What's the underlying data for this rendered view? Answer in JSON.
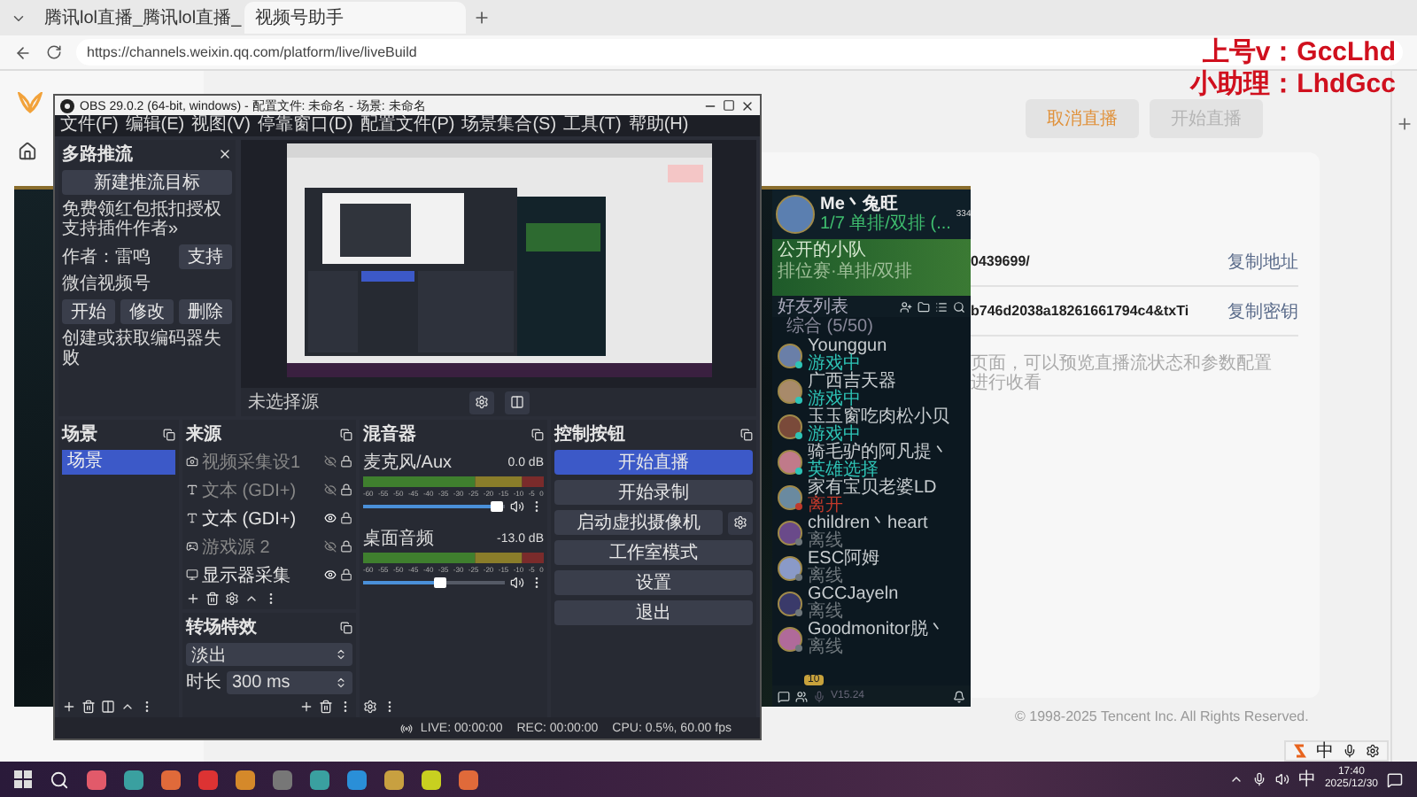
{
  "browser": {
    "tabs": [
      {
        "title": "腾讯lol直播_腾讯lol直播_",
        "selected": false
      },
      {
        "title": "视频号助手",
        "selected": true
      }
    ],
    "url": "https://channels.weixin.qq.com/platform/live/liveBuild"
  },
  "page": {
    "buttons": [
      {
        "label": "取消直播",
        "kind": "cancel"
      },
      {
        "label": "开始直播",
        "kind": "disabled"
      }
    ],
    "rows": [
      {
        "value": "0439699/",
        "action": "复制地址"
      },
      {
        "value": "b746d2038a18261661794c4&txTi",
        "action": "复制密钥"
      }
    ],
    "notes": [
      "页面，可以预览直播流状态和参数配置",
      "进行收看"
    ],
    "copyright": "© 1998-2025 Tencent Inc. All Rights Reserved."
  },
  "overlay": [
    "上号v：GccLhd",
    "小助理：LhdGcc"
  ],
  "obs": {
    "title": "OBS 29.0.2 (64-bit, windows) - 配置文件: 未命名 - 场景: 未命名",
    "menu": [
      "文件(F)",
      "编辑(E)",
      "视图(V)",
      "停靠窗口(D)",
      "配置文件(P)",
      "场景集合(S)",
      "工具(T)",
      "帮助(H)"
    ],
    "multistream": {
      "title": "多路推流",
      "new_button": "新建推流目标",
      "promo": "免费领红包抵扣授权支持插件作者»",
      "author": "作者：雷鸣",
      "support_button": "支持",
      "target": "微信视频号",
      "target_buttons": [
        "开始",
        "修改",
        "删除"
      ],
      "error": "创建或获取编码器失败"
    },
    "preview": {
      "source_label": "未选择源"
    },
    "scenes": {
      "title": "场景",
      "items": [
        {
          "name": "场景",
          "selected": true
        }
      ]
    },
    "sources": {
      "title": "来源",
      "items": [
        {
          "name": "视频采集设1",
          "kind": "camera",
          "visible": false
        },
        {
          "name": "文本 (GDI+)",
          "kind": "text",
          "visible": false
        },
        {
          "name": "文本 (GDI+)",
          "kind": "text",
          "visible": true
        },
        {
          "name": "游戏源 2",
          "kind": "game",
          "visible": false
        },
        {
          "name": "显示器采集",
          "kind": "monitor",
          "visible": true
        }
      ]
    },
    "transitions": {
      "title": "转场特效",
      "type": "淡出",
      "duration_label": "时长",
      "duration": "300 ms"
    },
    "mixer": {
      "title": "混音器",
      "channels": [
        {
          "name": "麦克风/Aux",
          "reading": "0.0 dB",
          "level": 0.95,
          "ticks": [
            "-60",
            "-55",
            "-50",
            "-45",
            "-40",
            "-35",
            "-30",
            "-25",
            "-20",
            "-15",
            "-10",
            "-5",
            "0"
          ]
        },
        {
          "name": "桌面音频",
          "reading": "-13.0 dB",
          "level": 0.55,
          "ticks": [
            "-60",
            "-55",
            "-50",
            "-45",
            "-40",
            "-35",
            "-30",
            "-25",
            "-20",
            "-15",
            "-10",
            "-5",
            "0"
          ]
        }
      ]
    },
    "controls": {
      "title": "控制按钮",
      "buttons": [
        {
          "label": "开始直播",
          "selected": true,
          "kind": "plain"
        },
        {
          "label": "开始录制",
          "selected": false,
          "kind": "plain"
        },
        {
          "label": "启动虚拟摄像机",
          "selected": false,
          "kind": "with_settings"
        },
        {
          "label": "工作室模式",
          "selected": false,
          "kind": "plain"
        },
        {
          "label": "设置",
          "selected": false,
          "kind": "plain"
        },
        {
          "label": "退出",
          "selected": false,
          "kind": "plain"
        }
      ]
    },
    "status": {
      "live": "LIVE: 00:00:00",
      "rec": "REC: 00:00:00",
      "cpu": "CPU: 0.5%, 60.00 fps"
    }
  },
  "game_client": {
    "profile": {
      "name": "Me丶兔旺",
      "status": "1/7 单排/双排 (...",
      "level": "334"
    },
    "party": {
      "title": "公开的小队",
      "mode": "排位赛·单排/双排"
    },
    "friends_title": "好友列表",
    "group": "综合 (5/50)",
    "friends": [
      {
        "name": "Younggun",
        "status": "游戏中",
        "color": "#2ec4b6"
      },
      {
        "name": "广西吉天器",
        "status": "游戏中",
        "color": "#2ec4b6"
      },
      {
        "name": "玉玉窗吃肉松小贝",
        "status": "游戏中",
        "color": "#2ec4b6"
      },
      {
        "name": "骑毛驴的阿凡提丶",
        "status": "英雄选择",
        "color": "#2ec4b6"
      },
      {
        "name": "家有宝贝老婆LD",
        "status": "离开",
        "color": "#c0392b"
      },
      {
        "name": "children丶heart",
        "status": "离线",
        "color": "#6f777c"
      },
      {
        "name": "ESC阿姆",
        "status": "离线",
        "color": "#6f777c"
      },
      {
        "name": "GCCJayeln",
        "status": "离线",
        "color": "#6f777c"
      },
      {
        "name": "Goodmonitor脱丶",
        "status": "离线",
        "color": "#6f777c"
      }
    ],
    "badge": "10",
    "version": "V15.24"
  },
  "ime": {
    "mode": "中"
  },
  "taskbar": {
    "tray_ime": "中",
    "time": "17:40",
    "date": "2025/12/30"
  }
}
